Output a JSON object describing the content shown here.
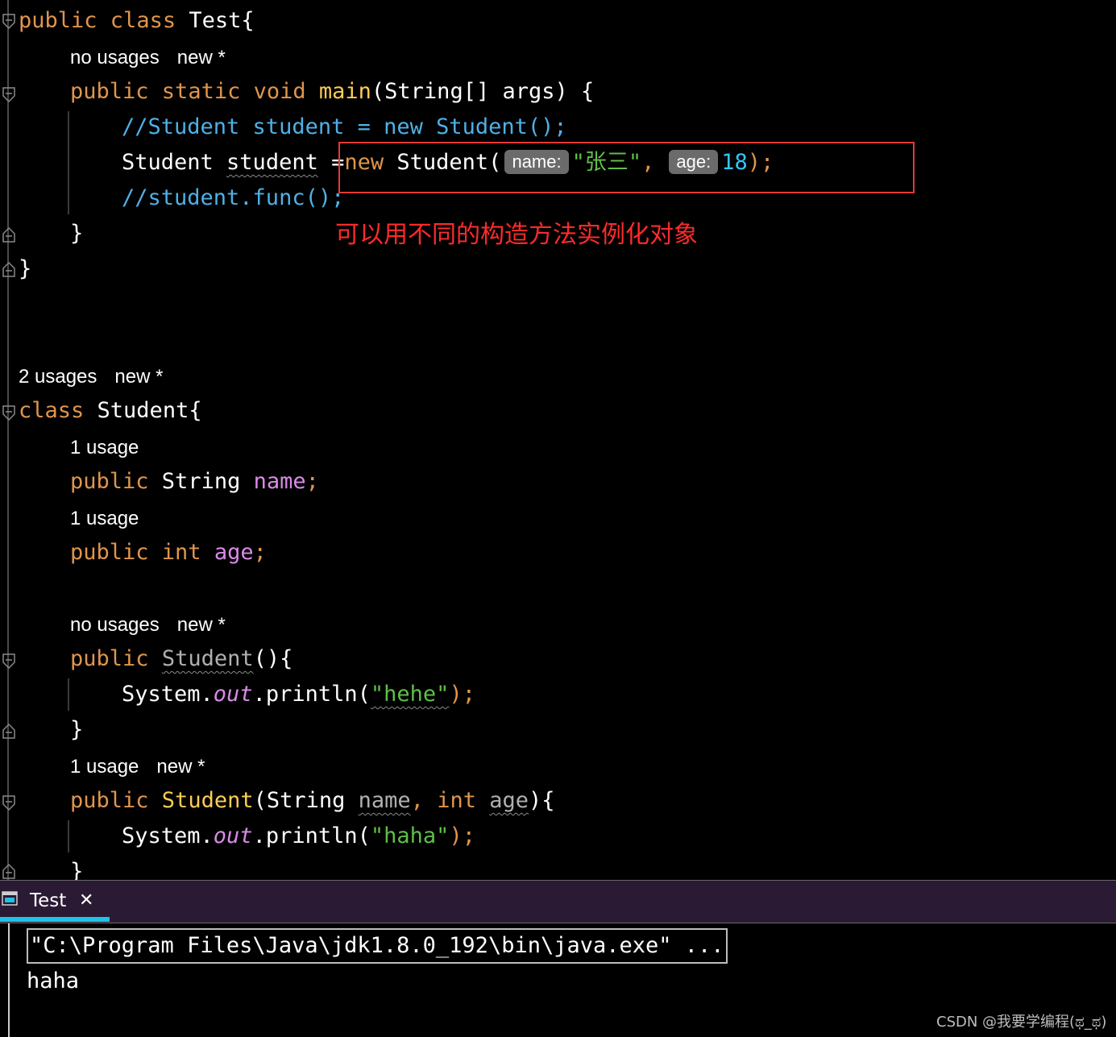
{
  "editor": {
    "test_class_decl": [
      "public",
      " class ",
      "Test{"
    ],
    "hint_main": [
      "no usages",
      "new *"
    ],
    "main_sig": [
      "public",
      " static",
      " void",
      " main",
      "(String[] args) {"
    ],
    "comment1": "//Student student = new Student();",
    "student_line": {
      "type": "Student ",
      "var": "student",
      "eq": " =",
      "kw_new": "new",
      "ctor": " Student(",
      "hint_name": "name:",
      "arg_name": "\"张三\"",
      "comma": ",",
      "hint_age": "age:",
      "arg_age": "18",
      "close": ");"
    },
    "comment2": "//student.func();",
    "close_brace": "}",
    "hint_student_class": [
      "2 usages",
      "new *"
    ],
    "student_class_decl": [
      "class",
      " Student{"
    ],
    "hint_name_field": "1 usage",
    "name_field": [
      "public",
      " String ",
      "name",
      ";"
    ],
    "hint_age_field": "1 usage",
    "age_field": [
      "public",
      " int ",
      "age",
      ";"
    ],
    "hint_ctor1": [
      "no usages",
      "new *"
    ],
    "ctor1_sig": [
      "public",
      " ",
      "Student",
      "(){"
    ],
    "println1": [
      "System.",
      "out",
      ".println(",
      "\"hehe\"",
      ");"
    ],
    "hint_ctor2": [
      "1 usage",
      "new *"
    ],
    "ctor2_sig": [
      "public",
      " Student",
      "(String ",
      "name",
      ",",
      " int ",
      "age",
      "){"
    ],
    "println2": [
      "System.",
      "out",
      ".println(",
      "\"haha\"",
      ");"
    ]
  },
  "annotation": "可以用不同的构造方法实例化对象",
  "run_panel": {
    "tab_label": "Test",
    "tab_close": "✕",
    "command": "\"C:\\Program Files\\Java\\jdk1.8.0_192\\bin\\java.exe\" ...",
    "output": "haha"
  },
  "watermark": "CSDN @我要学编程(ಥ_ಥ)",
  "colors": {
    "keyword": "#e0954c",
    "method": "#ffcc55",
    "comment": "#4fb0e8",
    "string": "#5fbf48",
    "field": "#d98be8",
    "number": "#34c5ff",
    "annotation": "#ff2a2a",
    "tab_accent": "#1fc2e8"
  }
}
